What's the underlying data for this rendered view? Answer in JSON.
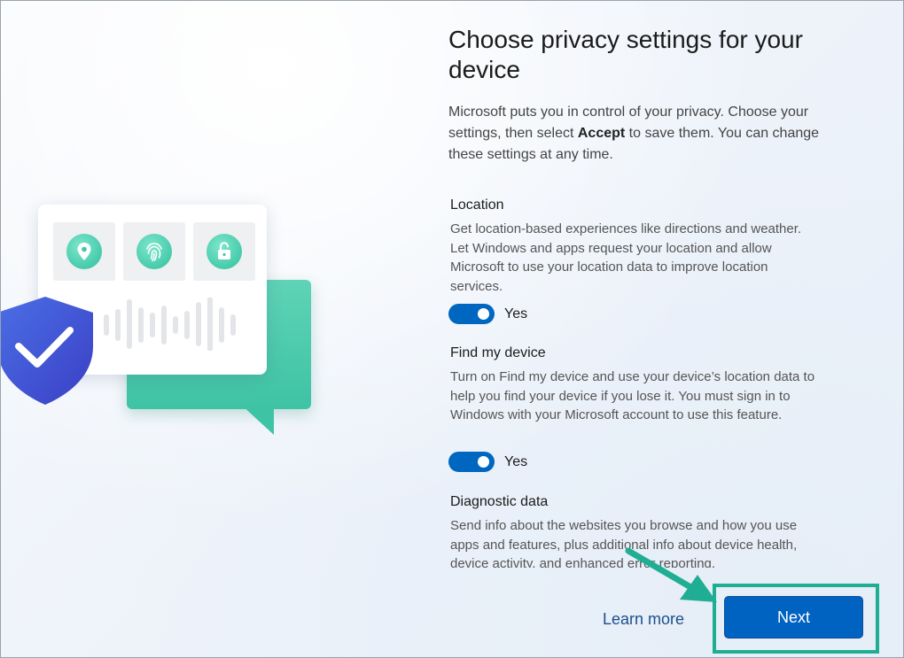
{
  "page": {
    "title": "Choose privacy settings for your device",
    "intro_before": "Microsoft puts you in control of your privacy. Choose your settings, then select ",
    "intro_bold": "Accept",
    "intro_after": " to save them. You can change these settings at any time."
  },
  "sections": [
    {
      "heading": "Location",
      "description": "Get location-based experiences like directions and weather. Let Windows and apps request your location and allow Microsoft to use your location data to improve location services.",
      "toggle_label": "Yes",
      "toggle_on": true
    },
    {
      "heading": "Find my device",
      "description": "Turn on Find my device and use your device’s location data to help you find your device if you lose it. You must sign in to Windows with your Microsoft account to use this feature.",
      "toggle_label": "Yes",
      "toggle_on": true
    },
    {
      "heading": "Diagnostic data",
      "description": "Send info about the websites you browse and how you use apps and features, plus additional info about device health, device activity, and enhanced error reporting."
    }
  ],
  "footer": {
    "learn_more": "Learn more",
    "next": "Next"
  },
  "colors": {
    "accent": "#0063c1",
    "highlight": "#1fae94",
    "teal": "#3ec3a4",
    "shield": "#3a5ad8"
  },
  "illustration": {
    "icons": [
      "location-pin-icon",
      "fingerprint-icon",
      "unlock-icon",
      "shield-check-icon"
    ]
  }
}
